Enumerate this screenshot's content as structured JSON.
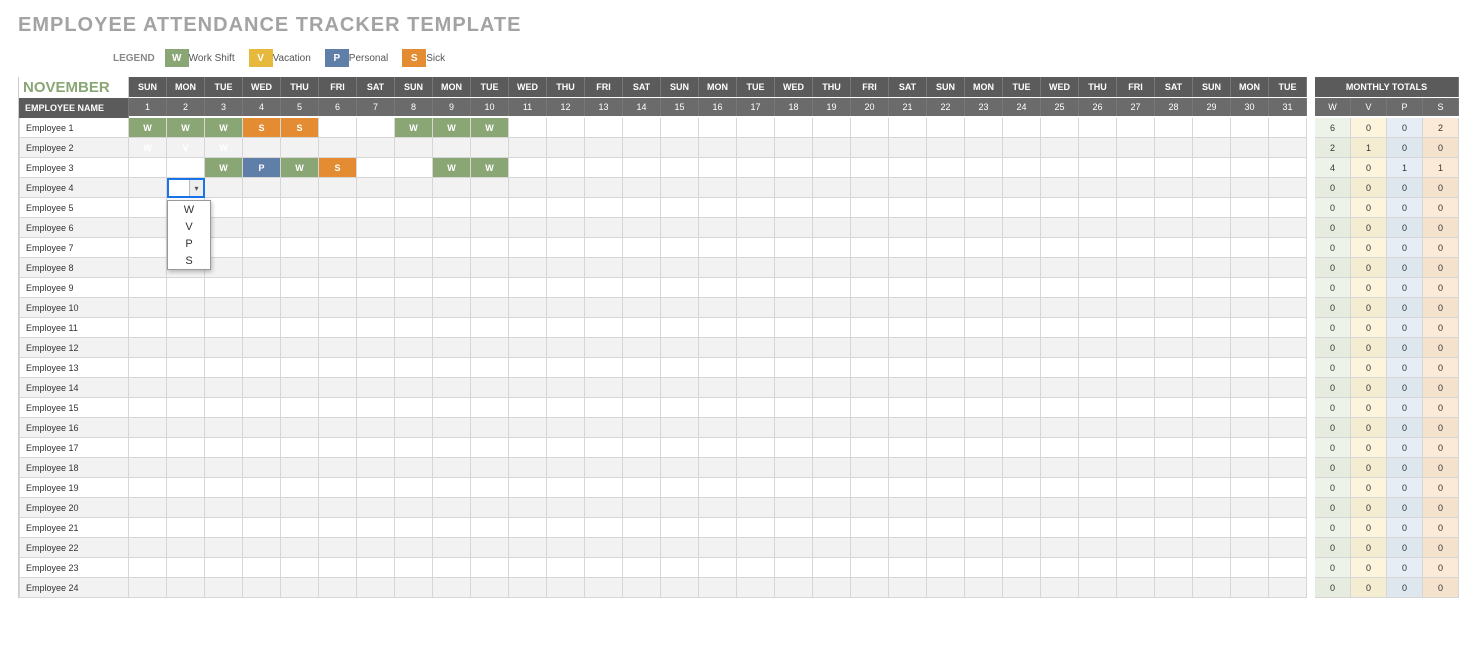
{
  "title": "EMPLOYEE ATTENDANCE TRACKER TEMPLATE",
  "legend": {
    "label": "LEGEND",
    "items": [
      {
        "code": "W",
        "text": "Work Shift"
      },
      {
        "code": "V",
        "text": "Vacation"
      },
      {
        "code": "P",
        "text": "Personal"
      },
      {
        "code": "S",
        "text": "Sick"
      }
    ]
  },
  "month": "NOVEMBER",
  "name_header": "EMPLOYEE NAME",
  "totals_header": "MONTHLY TOTALS",
  "totals_cols": [
    "W",
    "V",
    "P",
    "S"
  ],
  "day_headers": [
    "SUN",
    "MON",
    "TUE",
    "WED",
    "THU",
    "FRI",
    "SAT",
    "SUN",
    "MON",
    "TUE",
    "WED",
    "THU",
    "FRI",
    "SAT",
    "SUN",
    "MON",
    "TUE",
    "WED",
    "THU",
    "FRI",
    "SAT",
    "SUN",
    "MON",
    "TUE",
    "WED",
    "THU",
    "FRI",
    "SAT",
    "SUN",
    "MON",
    "TUE"
  ],
  "day_numbers": [
    "1",
    "2",
    "3",
    "4",
    "5",
    "6",
    "7",
    "8",
    "9",
    "10",
    "11",
    "12",
    "13",
    "14",
    "15",
    "16",
    "17",
    "18",
    "19",
    "20",
    "21",
    "22",
    "23",
    "24",
    "25",
    "26",
    "27",
    "28",
    "29",
    "30",
    "31"
  ],
  "rows": [
    {
      "name": "Employee 1",
      "days": [
        "W",
        "W",
        "W",
        "S",
        "S",
        "",
        "",
        "W",
        "W",
        "W",
        "",
        "",
        "",
        "",
        "",
        "",
        "",
        "",
        "",
        "",
        "",
        "",
        "",
        "",
        "",
        "",
        "",
        "",
        "",
        "",
        ""
      ],
      "totals": [
        6,
        0,
        0,
        2
      ]
    },
    {
      "name": "Employee 2",
      "days": [
        "W",
        "V",
        "W",
        "",
        "",
        "",
        "",
        "",
        "",
        "",
        "",
        "",
        "",
        "",
        "",
        "",
        "",
        "",
        "",
        "",
        "",
        "",
        "",
        "",
        "",
        "",
        "",
        "",
        "",
        "",
        ""
      ],
      "totals": [
        2,
        1,
        0,
        0
      ]
    },
    {
      "name": "Employee 3",
      "days": [
        "",
        "",
        "W",
        "P",
        "W",
        "S",
        "",
        "",
        "W",
        "W",
        "",
        "",
        "",
        "",
        "",
        "",
        "",
        "",
        "",
        "",
        "",
        "",
        "",
        "",
        "",
        "",
        "",
        "",
        "",
        "",
        ""
      ],
      "totals": [
        4,
        0,
        1,
        1
      ]
    },
    {
      "name": "Employee 4",
      "days": [
        "",
        "",
        "",
        "",
        "",
        "",
        "",
        "",
        "",
        "",
        "",
        "",
        "",
        "",
        "",
        "",
        "",
        "",
        "",
        "",
        "",
        "",
        "",
        "",
        "",
        "",
        "",
        "",
        "",
        "",
        ""
      ],
      "totals": [
        0,
        0,
        0,
        0
      ]
    },
    {
      "name": "Employee 5",
      "days": [
        "",
        "",
        "",
        "",
        "",
        "",
        "",
        "",
        "",
        "",
        "",
        "",
        "",
        "",
        "",
        "",
        "",
        "",
        "",
        "",
        "",
        "",
        "",
        "",
        "",
        "",
        "",
        "",
        "",
        "",
        ""
      ],
      "totals": [
        0,
        0,
        0,
        0
      ]
    },
    {
      "name": "Employee 6",
      "days": [
        "",
        "",
        "",
        "",
        "",
        "",
        "",
        "",
        "",
        "",
        "",
        "",
        "",
        "",
        "",
        "",
        "",
        "",
        "",
        "",
        "",
        "",
        "",
        "",
        "",
        "",
        "",
        "",
        "",
        "",
        ""
      ],
      "totals": [
        0,
        0,
        0,
        0
      ]
    },
    {
      "name": "Employee 7",
      "days": [
        "",
        "",
        "",
        "",
        "",
        "",
        "",
        "",
        "",
        "",
        "",
        "",
        "",
        "",
        "",
        "",
        "",
        "",
        "",
        "",
        "",
        "",
        "",
        "",
        "",
        "",
        "",
        "",
        "",
        "",
        ""
      ],
      "totals": [
        0,
        0,
        0,
        0
      ]
    },
    {
      "name": "Employee 8",
      "days": [
        "",
        "",
        "",
        "",
        "",
        "",
        "",
        "",
        "",
        "",
        "",
        "",
        "",
        "",
        "",
        "",
        "",
        "",
        "",
        "",
        "",
        "",
        "",
        "",
        "",
        "",
        "",
        "",
        "",
        "",
        ""
      ],
      "totals": [
        0,
        0,
        0,
        0
      ]
    },
    {
      "name": "Employee 9",
      "days": [
        "",
        "",
        "",
        "",
        "",
        "",
        "",
        "",
        "",
        "",
        "",
        "",
        "",
        "",
        "",
        "",
        "",
        "",
        "",
        "",
        "",
        "",
        "",
        "",
        "",
        "",
        "",
        "",
        "",
        "",
        ""
      ],
      "totals": [
        0,
        0,
        0,
        0
      ]
    },
    {
      "name": "Employee 10",
      "days": [
        "",
        "",
        "",
        "",
        "",
        "",
        "",
        "",
        "",
        "",
        "",
        "",
        "",
        "",
        "",
        "",
        "",
        "",
        "",
        "",
        "",
        "",
        "",
        "",
        "",
        "",
        "",
        "",
        "",
        "",
        ""
      ],
      "totals": [
        0,
        0,
        0,
        0
      ]
    },
    {
      "name": "Employee 11",
      "days": [
        "",
        "",
        "",
        "",
        "",
        "",
        "",
        "",
        "",
        "",
        "",
        "",
        "",
        "",
        "",
        "",
        "",
        "",
        "",
        "",
        "",
        "",
        "",
        "",
        "",
        "",
        "",
        "",
        "",
        "",
        ""
      ],
      "totals": [
        0,
        0,
        0,
        0
      ]
    },
    {
      "name": "Employee 12",
      "days": [
        "",
        "",
        "",
        "",
        "",
        "",
        "",
        "",
        "",
        "",
        "",
        "",
        "",
        "",
        "",
        "",
        "",
        "",
        "",
        "",
        "",
        "",
        "",
        "",
        "",
        "",
        "",
        "",
        "",
        "",
        ""
      ],
      "totals": [
        0,
        0,
        0,
        0
      ]
    },
    {
      "name": "Employee 13",
      "days": [
        "",
        "",
        "",
        "",
        "",
        "",
        "",
        "",
        "",
        "",
        "",
        "",
        "",
        "",
        "",
        "",
        "",
        "",
        "",
        "",
        "",
        "",
        "",
        "",
        "",
        "",
        "",
        "",
        "",
        "",
        ""
      ],
      "totals": [
        0,
        0,
        0,
        0
      ]
    },
    {
      "name": "Employee 14",
      "days": [
        "",
        "",
        "",
        "",
        "",
        "",
        "",
        "",
        "",
        "",
        "",
        "",
        "",
        "",
        "",
        "",
        "",
        "",
        "",
        "",
        "",
        "",
        "",
        "",
        "",
        "",
        "",
        "",
        "",
        "",
        ""
      ],
      "totals": [
        0,
        0,
        0,
        0
      ]
    },
    {
      "name": "Employee 15",
      "days": [
        "",
        "",
        "",
        "",
        "",
        "",
        "",
        "",
        "",
        "",
        "",
        "",
        "",
        "",
        "",
        "",
        "",
        "",
        "",
        "",
        "",
        "",
        "",
        "",
        "",
        "",
        "",
        "",
        "",
        "",
        ""
      ],
      "totals": [
        0,
        0,
        0,
        0
      ]
    },
    {
      "name": "Employee 16",
      "days": [
        "",
        "",
        "",
        "",
        "",
        "",
        "",
        "",
        "",
        "",
        "",
        "",
        "",
        "",
        "",
        "",
        "",
        "",
        "",
        "",
        "",
        "",
        "",
        "",
        "",
        "",
        "",
        "",
        "",
        "",
        ""
      ],
      "totals": [
        0,
        0,
        0,
        0
      ]
    },
    {
      "name": "Employee 17",
      "days": [
        "",
        "",
        "",
        "",
        "",
        "",
        "",
        "",
        "",
        "",
        "",
        "",
        "",
        "",
        "",
        "",
        "",
        "",
        "",
        "",
        "",
        "",
        "",
        "",
        "",
        "",
        "",
        "",
        "",
        "",
        ""
      ],
      "totals": [
        0,
        0,
        0,
        0
      ]
    },
    {
      "name": "Employee 18",
      "days": [
        "",
        "",
        "",
        "",
        "",
        "",
        "",
        "",
        "",
        "",
        "",
        "",
        "",
        "",
        "",
        "",
        "",
        "",
        "",
        "",
        "",
        "",
        "",
        "",
        "",
        "",
        "",
        "",
        "",
        "",
        ""
      ],
      "totals": [
        0,
        0,
        0,
        0
      ]
    },
    {
      "name": "Employee 19",
      "days": [
        "",
        "",
        "",
        "",
        "",
        "",
        "",
        "",
        "",
        "",
        "",
        "",
        "",
        "",
        "",
        "",
        "",
        "",
        "",
        "",
        "",
        "",
        "",
        "",
        "",
        "",
        "",
        "",
        "",
        "",
        ""
      ],
      "totals": [
        0,
        0,
        0,
        0
      ]
    },
    {
      "name": "Employee 20",
      "days": [
        "",
        "",
        "",
        "",
        "",
        "",
        "",
        "",
        "",
        "",
        "",
        "",
        "",
        "",
        "",
        "",
        "",
        "",
        "",
        "",
        "",
        "",
        "",
        "",
        "",
        "",
        "",
        "",
        "",
        "",
        ""
      ],
      "totals": [
        0,
        0,
        0,
        0
      ]
    },
    {
      "name": "Employee 21",
      "days": [
        "",
        "",
        "",
        "",
        "",
        "",
        "",
        "",
        "",
        "",
        "",
        "",
        "",
        "",
        "",
        "",
        "",
        "",
        "",
        "",
        "",
        "",
        "",
        "",
        "",
        "",
        "",
        "",
        "",
        "",
        ""
      ],
      "totals": [
        0,
        0,
        0,
        0
      ]
    },
    {
      "name": "Employee 22",
      "days": [
        "",
        "",
        "",
        "",
        "",
        "",
        "",
        "",
        "",
        "",
        "",
        "",
        "",
        "",
        "",
        "",
        "",
        "",
        "",
        "",
        "",
        "",
        "",
        "",
        "",
        "",
        "",
        "",
        "",
        "",
        ""
      ],
      "totals": [
        0,
        0,
        0,
        0
      ]
    },
    {
      "name": "Employee 23",
      "days": [
        "",
        "",
        "",
        "",
        "",
        "",
        "",
        "",
        "",
        "",
        "",
        "",
        "",
        "",
        "",
        "",
        "",
        "",
        "",
        "",
        "",
        "",
        "",
        "",
        "",
        "",
        "",
        "",
        "",
        "",
        ""
      ],
      "totals": [
        0,
        0,
        0,
        0
      ]
    },
    {
      "name": "Employee 24",
      "days": [
        "",
        "",
        "",
        "",
        "",
        "",
        "",
        "",
        "",
        "",
        "",
        "",
        "",
        "",
        "",
        "",
        "",
        "",
        "",
        "",
        "",
        "",
        "",
        "",
        "",
        "",
        "",
        "",
        "",
        "",
        ""
      ],
      "totals": [
        0,
        0,
        0,
        0
      ]
    }
  ],
  "active_cell": {
    "row": 3,
    "day": 1
  },
  "dropdown_options": [
    "W",
    "V",
    "P",
    "S"
  ]
}
